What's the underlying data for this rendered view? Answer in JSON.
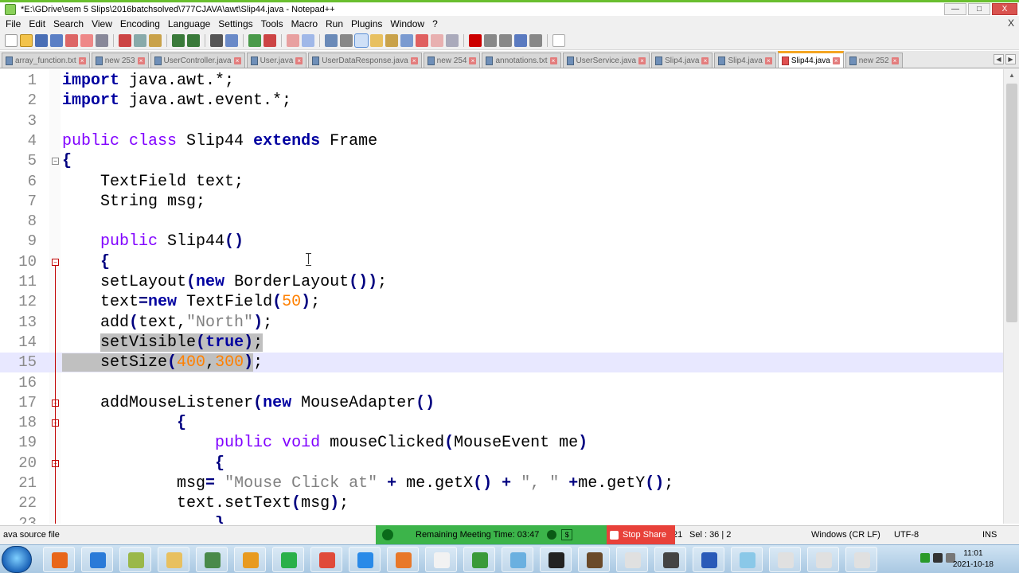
{
  "window": {
    "title": "*E:\\GDrive\\sem 5 Slips\\2016batchsolved\\777CJAVA\\awt\\Slip44.java - Notepad++",
    "min_label": "—",
    "max_label": "□",
    "close_label": "X"
  },
  "menu": {
    "items": [
      "File",
      "Edit",
      "Search",
      "View",
      "Encoding",
      "Language",
      "Settings",
      "Tools",
      "Macro",
      "Run",
      "Plugins",
      "Window",
      "?"
    ],
    "close_label": "X"
  },
  "tabs": [
    {
      "label": "array_function.txt"
    },
    {
      "label": "new 253"
    },
    {
      "label": "UserController.java"
    },
    {
      "label": "User.java"
    },
    {
      "label": "UserDataResponse.java"
    },
    {
      "label": "new 254"
    },
    {
      "label": "annotations.txt"
    },
    {
      "label": "UserService.java"
    },
    {
      "label": "Slip4.java"
    },
    {
      "label": "Slip4.java"
    },
    {
      "label": "Slip44.java",
      "active": true
    },
    {
      "label": "new 252"
    }
  ],
  "tab_close_glyph": "×",
  "editor": {
    "lines": [
      {
        "n": "1",
        "tokens": [
          [
            "kw",
            "import"
          ],
          [
            "plain",
            " java.awt.*;"
          ]
        ]
      },
      {
        "n": "2",
        "tokens": [
          [
            "kw",
            "import"
          ],
          [
            "plain",
            " java.awt.event.*;"
          ]
        ]
      },
      {
        "n": "3",
        "tokens": []
      },
      {
        "n": "4",
        "tokens": [
          [
            "kw2",
            "public"
          ],
          [
            "plain",
            " "
          ],
          [
            "kw2",
            "class"
          ],
          [
            "plain",
            " Slip44 "
          ],
          [
            "kw",
            "extends"
          ],
          [
            "plain",
            " Frame"
          ]
        ]
      },
      {
        "n": "5",
        "tokens": [
          [
            "op",
            "{"
          ]
        ]
      },
      {
        "n": "6",
        "tokens": [
          [
            "plain",
            "    TextField text;"
          ]
        ]
      },
      {
        "n": "7",
        "tokens": [
          [
            "plain",
            "    String msg;"
          ]
        ]
      },
      {
        "n": "8",
        "tokens": []
      },
      {
        "n": "9",
        "tokens": [
          [
            "plain",
            "    "
          ],
          [
            "kw2",
            "public"
          ],
          [
            "plain",
            " Slip44"
          ],
          [
            "op",
            "()"
          ]
        ]
      },
      {
        "n": "10",
        "tokens": [
          [
            "plain",
            "    "
          ],
          [
            "op",
            "{"
          ]
        ]
      },
      {
        "n": "11",
        "tokens": [
          [
            "plain",
            "    setLayout"
          ],
          [
            "op",
            "("
          ],
          [
            "kw",
            "new"
          ],
          [
            "plain",
            " BorderLayout"
          ],
          [
            "op",
            "())"
          ],
          [
            "plain",
            ";"
          ]
        ]
      },
      {
        "n": "12",
        "tokens": [
          [
            "plain",
            "    text"
          ],
          [
            "op",
            "="
          ],
          [
            "kw",
            "new"
          ],
          [
            "plain",
            " TextField"
          ],
          [
            "op",
            "("
          ],
          [
            "num-lit",
            "50"
          ],
          [
            "op",
            ")"
          ],
          [
            "plain",
            ";"
          ]
        ]
      },
      {
        "n": "13",
        "tokens": [
          [
            "plain",
            "    add"
          ],
          [
            "op",
            "("
          ],
          [
            "plain",
            "text,"
          ],
          [
            "str",
            "\"North\""
          ],
          [
            "op",
            ")"
          ],
          [
            "plain",
            ";"
          ]
        ]
      },
      {
        "n": "14",
        "tokens": [
          [
            "plain",
            "    "
          ],
          [
            "sel:plain",
            "setVisible"
          ],
          [
            "sel:op",
            "("
          ],
          [
            "sel:kw",
            "true"
          ],
          [
            "sel:op",
            ")"
          ],
          [
            "sel:plain",
            ";"
          ]
        ]
      },
      {
        "n": "15",
        "current": true,
        "tokens": [
          [
            "sel:plain",
            "    setSize"
          ],
          [
            "sel:op",
            "("
          ],
          [
            "sel:num-lit",
            "400"
          ],
          [
            "sel:plain",
            ","
          ],
          [
            "sel:num-lit",
            "300"
          ],
          [
            "sel:op",
            ")"
          ],
          [
            "plain",
            ";"
          ]
        ]
      },
      {
        "n": "16",
        "tokens": []
      },
      {
        "n": "17",
        "tokens": [
          [
            "plain",
            "    addMouseListener"
          ],
          [
            "op",
            "("
          ],
          [
            "kw",
            "new"
          ],
          [
            "plain",
            " MouseAdapter"
          ],
          [
            "op",
            "()"
          ]
        ]
      },
      {
        "n": "18",
        "tokens": [
          [
            "plain",
            "            "
          ],
          [
            "op",
            "{"
          ]
        ]
      },
      {
        "n": "19",
        "tokens": [
          [
            "plain",
            "                "
          ],
          [
            "kw2",
            "public"
          ],
          [
            "plain",
            " "
          ],
          [
            "kw2",
            "void"
          ],
          [
            "plain",
            " mouseClicked"
          ],
          [
            "op",
            "("
          ],
          [
            "plain",
            "MouseEvent me"
          ],
          [
            "op",
            ")"
          ]
        ]
      },
      {
        "n": "20",
        "tokens": [
          [
            "plain",
            "                "
          ],
          [
            "op",
            "{"
          ]
        ]
      },
      {
        "n": "21",
        "tokens": [
          [
            "plain",
            "            msg"
          ],
          [
            "op",
            "="
          ],
          [
            "plain",
            " "
          ],
          [
            "str",
            "\"Mouse Click at\""
          ],
          [
            "plain",
            " "
          ],
          [
            "op",
            "+"
          ],
          [
            "plain",
            " me.getX"
          ],
          [
            "op",
            "()"
          ],
          [
            "plain",
            " "
          ],
          [
            "op",
            "+"
          ],
          [
            "plain",
            " "
          ],
          [
            "str",
            "\", \""
          ],
          [
            "plain",
            " "
          ],
          [
            "op",
            "+"
          ],
          [
            "plain",
            "me.getY"
          ],
          [
            "op",
            "()"
          ],
          [
            "plain",
            ";"
          ]
        ]
      },
      {
        "n": "22",
        "tokens": [
          [
            "plain",
            "            text.setText"
          ],
          [
            "op",
            "("
          ],
          [
            "plain",
            "msg"
          ],
          [
            "op",
            ")"
          ],
          [
            "plain",
            ";"
          ]
        ]
      },
      {
        "n": "23",
        "tokens": [
          [
            "plain",
            "                "
          ],
          [
            "op",
            "}"
          ]
        ]
      }
    ]
  },
  "status": {
    "file_type": "ava source file",
    "position": "21",
    "selection": "Sel : 36 | 2",
    "eol": "Windows (CR LF)",
    "encoding": "UTF-8",
    "mode": "INS"
  },
  "meeting": {
    "remaining": "Remaining Meeting Time: 03:47",
    "dollar": "$",
    "stop_share": "Stop Share"
  },
  "clock": {
    "time": "11:01",
    "date": "2021-10-18"
  },
  "colors": {
    "keyword": "#0000a0",
    "type_keyword": "#8000ff",
    "string": "#808080",
    "number": "#ff8000",
    "selection": "#c0c0c0",
    "meeting_bar": "#3cb44a",
    "stop_share": "#e8413a",
    "active_tab_accent": "#f4a522"
  },
  "taskbar_apps": [
    "firefox-icon",
    "ie-icon",
    "tsv-icon",
    "explorer-icon",
    "tools-icon",
    "media-player-icon",
    "chrome-icon",
    "anydesk-icon",
    "zoom-icon",
    "app-icon",
    "xampp-icon",
    "chart-icon",
    "paint-icon",
    "cmd-icon",
    "package-icon",
    "java-icon",
    "sql-icon",
    "word-icon",
    "notepad-icon",
    "java-icon-2",
    "java-icon-3",
    "java-icon-4"
  ]
}
